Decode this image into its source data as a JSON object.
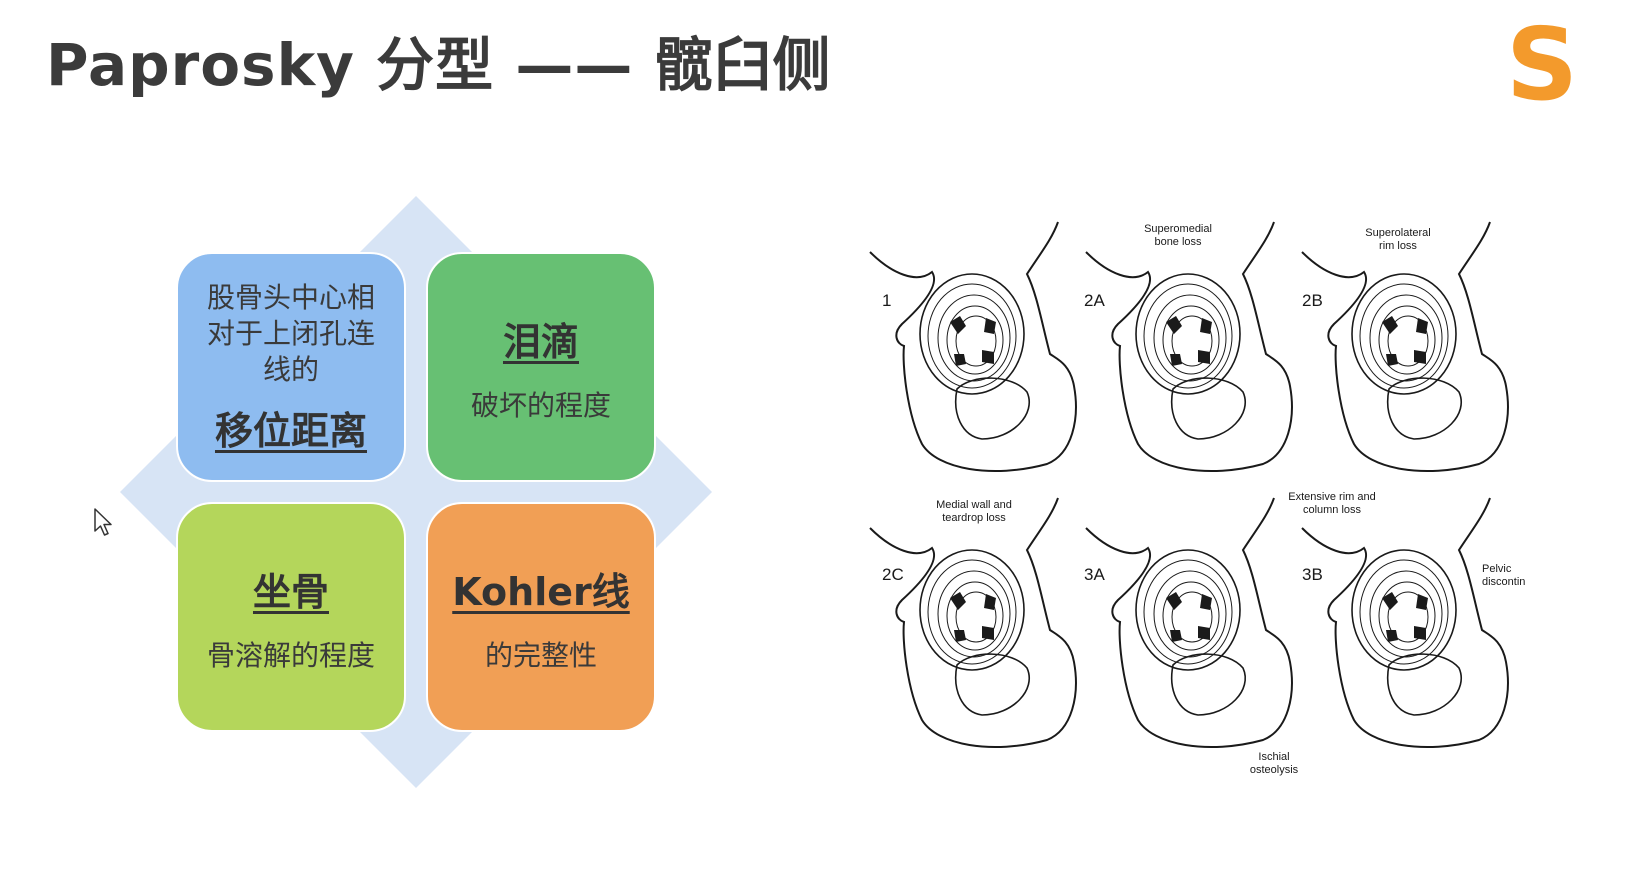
{
  "slide": {
    "title": "Paprosky 分型 —— 髋臼侧",
    "brand_letter": "S",
    "colors": {
      "title": "#3b3b3b",
      "brand": "#f39a2c",
      "diamond": "#d7e4f5"
    }
  },
  "matrix": {
    "tiles": [
      {
        "desc": "股骨头中心相对于上闭孔连线的",
        "key": "移位距离",
        "color": "#8ebcf0"
      },
      {
        "key": "泪滴",
        "desc": "破坏的程度",
        "color": "#67c073"
      },
      {
        "key": "坐骨",
        "desc": "骨溶解的程度",
        "color": "#b4d65b"
      },
      {
        "key": "Kohler线",
        "desc": "的完整性",
        "color": "#f19f55"
      }
    ]
  },
  "figure": {
    "panels": [
      {
        "label": "1"
      },
      {
        "label": "2A",
        "annotation_1": "Superomedial",
        "annotation_2": "bone loss"
      },
      {
        "label": "2B",
        "annotation_1": "Superolateral",
        "annotation_2": "rim loss"
      },
      {
        "label": "2C",
        "annotation_1": "Medial wall and",
        "annotation_2": "teardrop loss"
      },
      {
        "label": "3A",
        "annotation_1": "Extensive rim and",
        "annotation_2": "column loss"
      },
      {
        "label": "3B",
        "annotation_1": "Pelvic",
        "annotation_2": "discontinuity"
      }
    ],
    "bottom_annotation_1": "Ischial",
    "bottom_annotation_2": "osteolysis"
  },
  "cursor": {
    "icon": "arrow-cursor-icon"
  }
}
